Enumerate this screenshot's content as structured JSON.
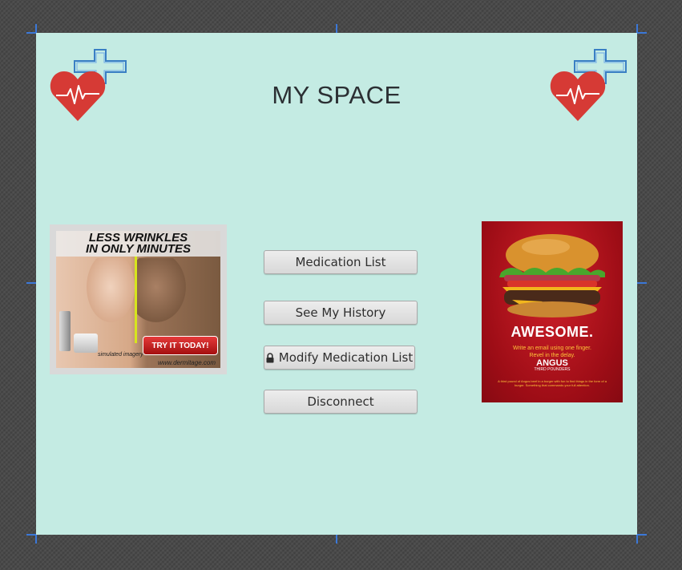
{
  "page": {
    "title": "MY SPACE"
  },
  "menu": {
    "medication_list": "Medication List",
    "see_history": "See My History",
    "modify_list": "Modify Medication List",
    "disconnect": "Disconnect"
  },
  "ads": {
    "left": {
      "headline_1": "LESS WRINKLES",
      "headline_2": "IN ONLY MINUTES",
      "note": "simulated imagery",
      "cta": "TRY IT TODAY!",
      "url": "www.dermitage.com"
    },
    "right": {
      "headline": "AWESOME.",
      "sub_1": "Write an email using one finger.",
      "sub_2": "Revel in the delay.",
      "brand": "ANGUS",
      "brand_sub": "THIRD POUNDERS",
      "fine_print": "A third pound of Angus beef in a burger with fun to find things in the form of a burger. Something that commands your full attention."
    }
  },
  "colors": {
    "canvas": "#c4ebe3",
    "heart": "#d63a35",
    "cross": "#3a7fc4",
    "marker": "#3b78d8"
  },
  "icons": {
    "logo": "heart-pulse-cross-icon",
    "lock": "lock-icon"
  }
}
